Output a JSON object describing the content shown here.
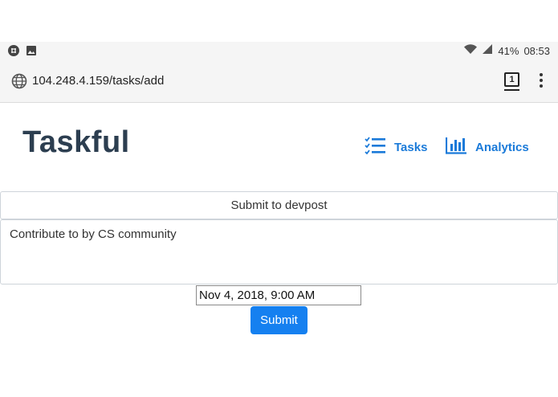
{
  "status_bar": {
    "left_icons": [
      "slack-notification-icon",
      "image-notification-icon"
    ],
    "right_icons": [
      "wifi-icon",
      "signal-icon"
    ],
    "battery": "41%",
    "time": "08:53"
  },
  "browser": {
    "url": "104.248.4.159/tasks/add",
    "tab_count": "1",
    "icons": [
      "globe-icon",
      "tabs-icon",
      "more-vert-icon"
    ]
  },
  "app": {
    "brand": "Taskful",
    "nav": [
      {
        "label": "Tasks",
        "icon": "checklist-icon"
      },
      {
        "label": "Analytics",
        "icon": "bar-chart-icon"
      }
    ]
  },
  "form": {
    "title_value": "Submit to devpost",
    "description_value": "Contribute to by CS community",
    "date_value": "Nov 4, 2018, 9:00 AM",
    "submit_label": "Submit"
  },
  "colors": {
    "brand_text": "#2c3e50",
    "link": "#1a7ad9",
    "primary_button": "#1580f0"
  }
}
